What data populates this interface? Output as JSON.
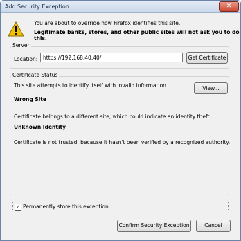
{
  "window": {
    "title": "Add Security Exception",
    "close_label": "✕"
  },
  "header": {
    "message": "You are about to override how Firefox identifies this site.",
    "warning": "Legitimate banks, stores, and other public sites will not ask you to do this."
  },
  "server": {
    "group_label": "Server",
    "location_label": "Location:",
    "location_value": "https://192.168.40.40/",
    "get_certificate_label": "Get Certificate"
  },
  "certificate_status": {
    "group_label": "Certificate Status",
    "intro": "This site attempts to identify itself with invalid information.",
    "view_label": "View...",
    "issue1_title": "Wrong Site",
    "issue1_desc": "Certificate belongs to a different site, which could indicate an identity theft.",
    "issue2_title": "Unknown Identity",
    "issue2_desc": "Certificate is not trusted, because it hasn't been verified by a recognized authority."
  },
  "permanent": {
    "label": "Permanently store this exception",
    "checked_mark": "✓"
  },
  "footer": {
    "confirm_label": "Confirm Security Exception",
    "cancel_label": "Cancel"
  },
  "colors": {
    "title_bar": "#c9d8ea",
    "close_button": "#c94832",
    "warning_icon": "#f2c200"
  }
}
